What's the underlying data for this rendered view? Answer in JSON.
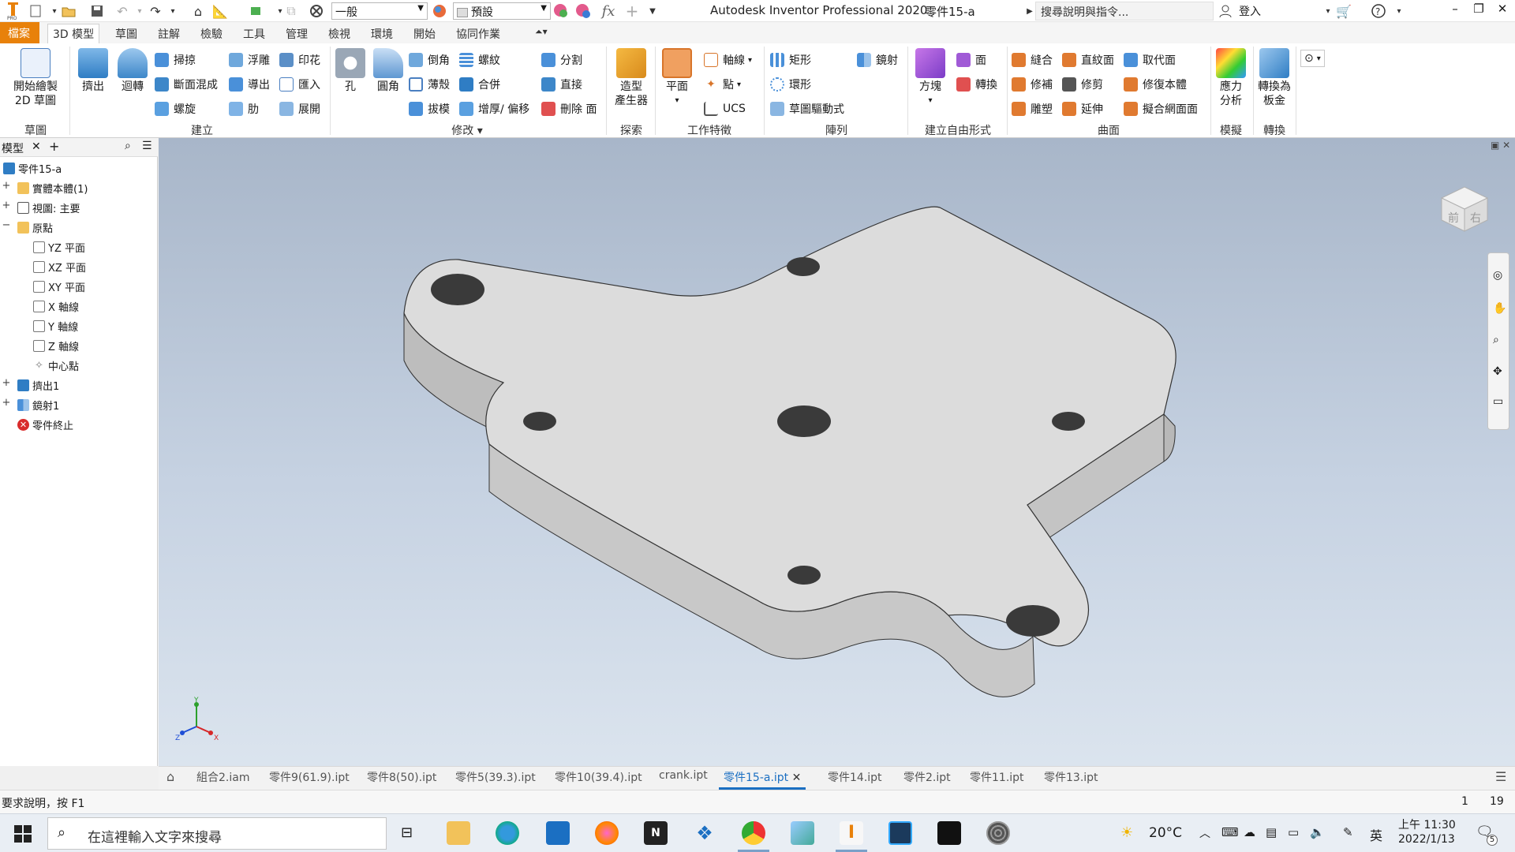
{
  "titlebar": {
    "app_title": "Autodesk Inventor Professional 2020",
    "doc_title": "零件15-a",
    "style_select": "一般",
    "appearance_select": "預設",
    "search_placeholder": "搜尋說明與指令...",
    "login": "登入",
    "icons": [
      "inventor-logo-icon",
      "new-file-icon",
      "open-icon",
      "save-icon",
      "undo-icon",
      "redo-icon",
      "home-icon",
      "measure-icon",
      "material-icon",
      "appearance-icon",
      "clear-override-icon",
      "fx-icon",
      "plus-icon",
      "customize-icon",
      "cart-icon",
      "help-icon",
      "minimize-icon",
      "restore-icon",
      "close-icon"
    ]
  },
  "tabs": {
    "file": "檔案",
    "items": [
      "3D 模型",
      "草圖",
      "註解",
      "檢驗",
      "工具",
      "管理",
      "檢視",
      "環境",
      "開始",
      "協同作業"
    ],
    "active": "3D 模型"
  },
  "ribbon": {
    "groups": {
      "sketch": "草圖",
      "create": "建立",
      "modify": "修改",
      "explore": "探索",
      "work_features": "工作特徵",
      "pattern": "陣列",
      "freeform": "建立自由形式",
      "surface": "曲面",
      "simulation": "模擬",
      "convert": "轉換"
    },
    "sketch_btn_line1": "開始繪製",
    "sketch_btn_line2": "2D 草圖",
    "extrude": "擠出",
    "revolve": "迴轉",
    "sweep": "掃掠",
    "loft": "斷面混成",
    "coil": "螺旋",
    "emboss": "浮雕",
    "derive": "導出",
    "rib": "肋",
    "decal": "印花",
    "import": "匯入",
    "unwrap": "展開",
    "hole": "孔",
    "fillet": "圓角",
    "chamfer": "倒角",
    "shell": "薄殼",
    "draft": "拔模",
    "thread": "螺紋",
    "combine": "合併",
    "thicken": "增厚/ 偏移",
    "split": "分割",
    "direct": "直接",
    "delete_face": "刪除 面",
    "shape_gen_line1": "造型",
    "shape_gen_line2": "產生器",
    "plane": "平面",
    "axis": "軸線",
    "point": "點",
    "ucs": "UCS",
    "rect_pattern": "矩形",
    "circ_pattern": "環形",
    "sketch_pattern": "草圖驅動式",
    "mirror": "鏡射",
    "box": "方塊",
    "face": "面",
    "convert_ff": "轉換",
    "stitch": "縫合",
    "patch": "修補",
    "sculpt": "雕塑",
    "ruled": "直紋面",
    "trim": "修剪",
    "extend": "延伸",
    "replace_face": "取代面",
    "repair": "修復本體",
    "fit_mesh": "擬合網面面",
    "stress_line1": "應力",
    "stress_line2": "分析",
    "convert_sm_line1": "轉換為",
    "convert_sm_line2": "板金"
  },
  "browser": {
    "tab": "模型",
    "root": "零件15-a",
    "items": [
      {
        "label": "實體本體(1)",
        "pm": "+"
      },
      {
        "label": "視圖: 主要",
        "pm": "+"
      },
      {
        "label": "原點",
        "pm": "−"
      },
      {
        "label": "YZ 平面",
        "pm": ""
      },
      {
        "label": "XZ 平面",
        "pm": ""
      },
      {
        "label": "XY 平面",
        "pm": ""
      },
      {
        "label": "X 軸線",
        "pm": ""
      },
      {
        "label": "Y 軸線",
        "pm": ""
      },
      {
        "label": "Z 軸線",
        "pm": ""
      },
      {
        "label": "中心點",
        "pm": ""
      },
      {
        "label": "擠出1",
        "pm": "+"
      },
      {
        "label": "鏡射1",
        "pm": "+"
      },
      {
        "label": "零件終止",
        "pm": ""
      }
    ]
  },
  "viewcube": {
    "front": "前",
    "right": "右"
  },
  "triad": {
    "x": "X",
    "y": "Y",
    "z": "Z"
  },
  "doctabs": {
    "items": [
      "組合2.iam",
      "零件9(61.9).ipt",
      "零件8(50).ipt",
      "零件5(39.3).ipt",
      "零件10(39.4).ipt",
      "crank.ipt",
      "零件15-a.ipt",
      "零件14.ipt",
      "零件2.ipt",
      "零件11.ipt",
      "零件13.ipt"
    ],
    "active": "零件15-a.ipt"
  },
  "status": {
    "help": "要求說明，按 F1",
    "count1": "1",
    "count2": "19"
  },
  "taskbar": {
    "search_placeholder": "在這裡輸入文字來搜尋",
    "temperature": "20°C",
    "ime": "英",
    "time": "上午 11:30",
    "date": "2022/1/13",
    "notifications": "5"
  },
  "colors": {
    "accent": "#1b6fc2",
    "file_tab": "#e8810a",
    "part_face": "#dcdcdc",
    "part_side": "#c8c8c8",
    "error": "#d92b2b"
  }
}
